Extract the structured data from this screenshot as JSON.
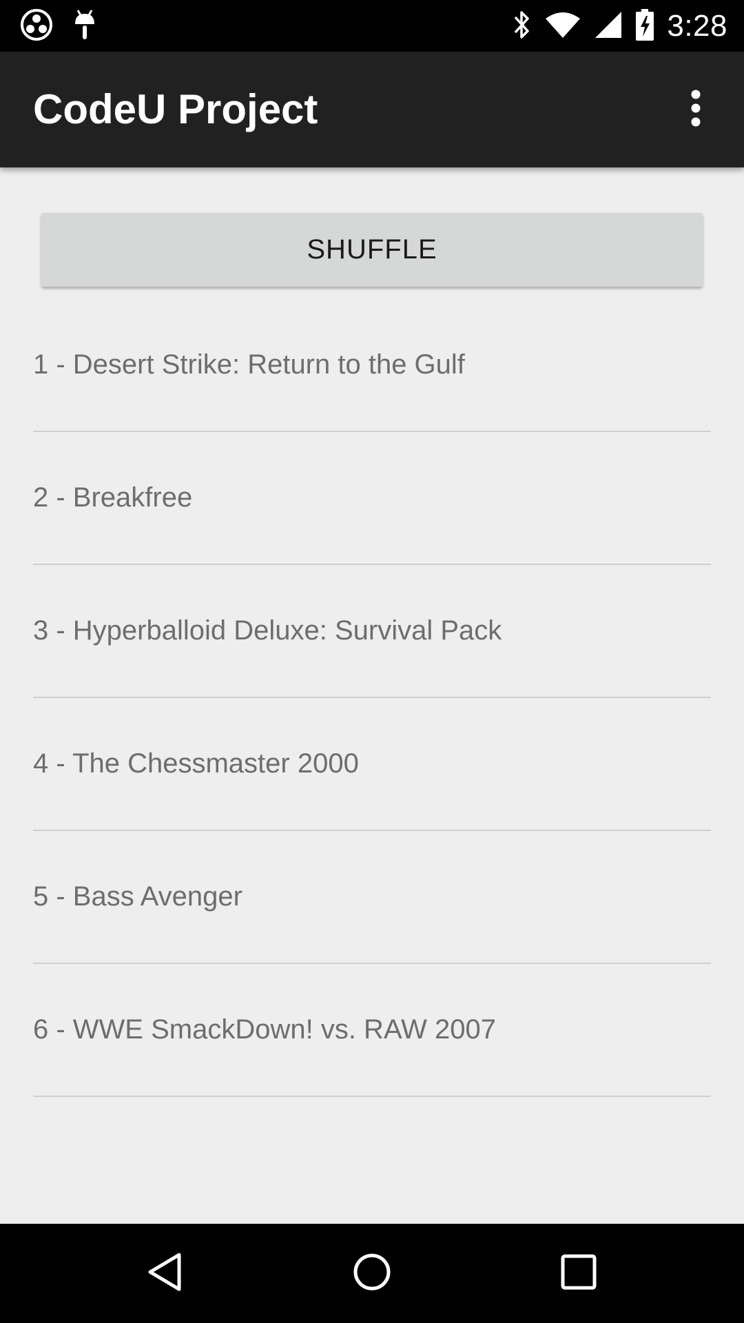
{
  "status_bar": {
    "time": "3:28",
    "left_icons": [
      "soccer-ball-icon",
      "android-debug-icon"
    ],
    "right_icons": [
      "bluetooth-icon",
      "wifi-icon",
      "cell-signal-icon",
      "battery-charging-icon"
    ]
  },
  "app_bar": {
    "title": "CodeU Project",
    "overflow_icon": "more-vert-icon"
  },
  "main": {
    "shuffle_label": "SHUFFLE",
    "items": [
      {
        "label": "1 - Desert Strike: Return to the Gulf"
      },
      {
        "label": "2 - Breakfree"
      },
      {
        "label": "3 - Hyperballoid Deluxe: Survival Pack"
      },
      {
        "label": "4 - The Chessmaster 2000"
      },
      {
        "label": "5 - Bass Avenger"
      },
      {
        "label": "6 - WWE SmackDown! vs. RAW 2007"
      }
    ]
  },
  "nav_bar": {
    "buttons": [
      "back-icon",
      "home-icon",
      "recents-icon"
    ]
  },
  "colors": {
    "status_bar_bg": "#000000",
    "app_bar_bg": "#212121",
    "content_bg": "#eeeeee",
    "button_bg": "#d6d7d7",
    "item_text": "#6d6d6d",
    "divider": "#cfcfcf"
  }
}
